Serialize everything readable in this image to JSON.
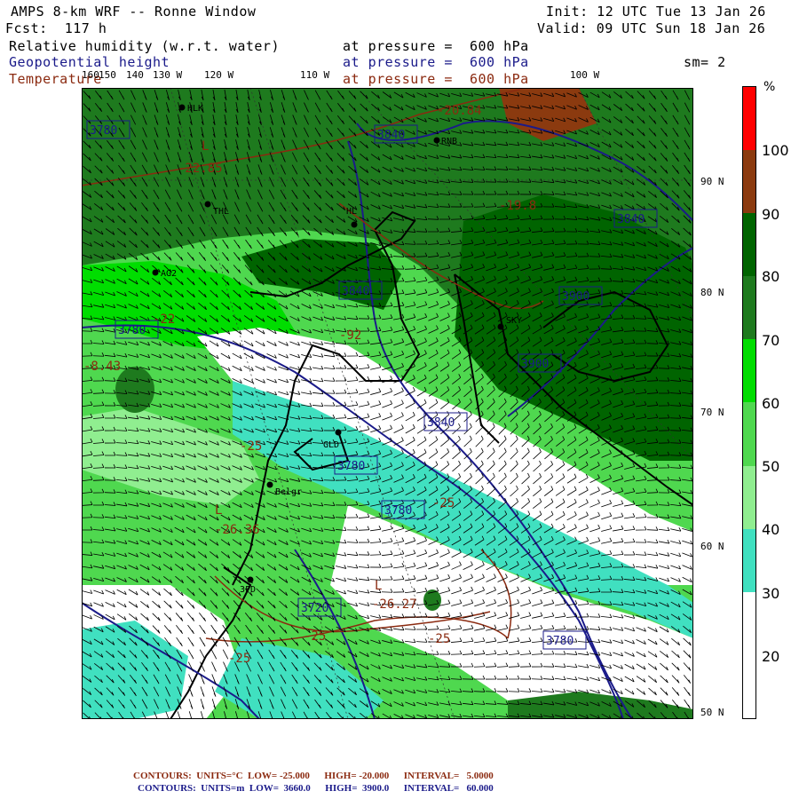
{
  "header": {
    "title": "AMPS 8-km WRF -- Ronne Window",
    "fcst": "Fcst:  117 h",
    "init": "Init: 12 UTC Tue 13 Jan 26",
    "valid": "Valid: 09 UTC Sun 18 Jan 26",
    "field1": "Relative humidity (w.r.t. water)",
    "field2": "Geopotential height",
    "field3": "Temperature",
    "pressure_line": "at pressure =  600 hPa",
    "smoothing": "sm= 2"
  },
  "longitude_labels": [
    "160",
    "150",
    "140",
    "130 W",
    "120 W",
    "110 W",
    "100 W"
  ],
  "latitude_labels": [
    "90 N",
    "80 N",
    "70 N",
    "60 N",
    "50 N"
  ],
  "colorbar": {
    "unit": "%",
    "levels": [
      "100",
      "90",
      "80",
      "70",
      "60",
      "50",
      "40",
      "30",
      "20"
    ],
    "colors": [
      "#ff0000",
      "#8b3a0f",
      "#006400",
      "#1e7a1e",
      "#00dd00",
      "#4fd84f",
      "#90ee90",
      "#40e0c0",
      "#ffffff"
    ]
  },
  "stations": [
    "HLK",
    "RNB",
    "THL",
    "HL",
    "AG2",
    "SKY",
    "GLD",
    "Belgr",
    "3FD"
  ],
  "height_labels": [
    "3780",
    "3840",
    "3840",
    "3840",
    "3900",
    "3900",
    "3780",
    "3840",
    "3780",
    "3780",
    "3720",
    "3780"
  ],
  "temp_labels": [
    "-20.84",
    "-22.85",
    "-19.8",
    "-8.43",
    "-26.36",
    "-26.27",
    "-25",
    "-25",
    "-25",
    "-25",
    "-25",
    "-22",
    "-92"
  ],
  "lows": [
    "L",
    "L",
    "L"
  ],
  "footer": {
    "line1": "CONTOURS:  UNITS=°C  LOW= -25.000      HIGH= -20.000      INTERVAL=   5.0000",
    "line2": "CONTOURS:  UNITS=m  LOW=  3660.0      HIGH=  3900.0      INTERVAL=   60.000"
  }
}
